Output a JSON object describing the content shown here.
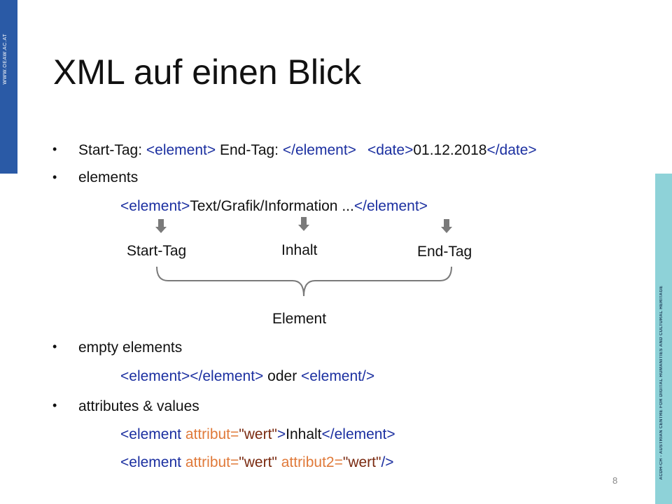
{
  "slide": {
    "title": "XML auf einen Blick",
    "left_band_text": "WWW.OEAW.AC.AT",
    "right_band_text": "ACDH-CH - AUSTRIAN CENTRE FOR DIGITAL HUMANITIES AND CULTURAL HERITAGE",
    "page_number": "8"
  },
  "bullet1": {
    "start_label": "Start-Tag: ",
    "start_tag": "<element>",
    "end_label": " End-Tag: ",
    "end_tag": "</element>",
    "ex_open": "<date>",
    "ex_value": "01.12.2018",
    "ex_close": "</date>"
  },
  "bullet2": {
    "label": "elements",
    "open_tag": "<element>",
    "content": "Text/Grafik/Information ...",
    "close_tag": "</element>"
  },
  "diagram": {
    "start_tag_label": "Start-Tag",
    "content_label": "Inhalt",
    "end_tag_label": "End-Tag",
    "element_label": "Element"
  },
  "bullet3": {
    "label": "empty elements",
    "open_tag": "<element>",
    "close_tag": "</element>",
    "oder": " oder ",
    "self_closing": "<element/>"
  },
  "bullet4": {
    "label": "attributes & values",
    "line1": {
      "tag_open": "<element ",
      "attr": "attribut=",
      "val": "\"wert\"",
      "tag_end": ">",
      "content": "Inhalt",
      "close_tag": "</element>"
    },
    "line2": {
      "tag_open": "<element ",
      "attr1": "attribut=",
      "val1": "\"wert\"",
      "space": " ",
      "attr2": "attribut2=",
      "val2": "\"wert\"",
      "tag_end": "/>"
    }
  },
  "colors": {
    "tag": "#1b2fa0",
    "attribute": "#e07a3a",
    "value": "#7a2a10",
    "left_band": "#2a5aa6",
    "right_band": "#8ed2d8"
  }
}
